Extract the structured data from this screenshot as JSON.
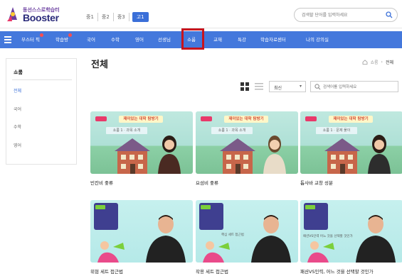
{
  "header": {
    "logo_sub": "동선스스로학습터",
    "logo_main": "Booster",
    "grade_tabs": [
      "중1",
      "중2",
      "중3",
      "고1"
    ],
    "active_grade": "고1",
    "search_placeholder": "검색할 단어를 입력하세요",
    "icons": {
      "logo": "booster-logo",
      "search": "search-icon"
    }
  },
  "nav": {
    "items": [
      "부스터 픽",
      "학습방",
      "국어",
      "수학",
      "영어",
      "선생님",
      "쇼룸",
      "교재",
      "특강",
      "학습자료센터",
      "나의 강의실"
    ],
    "badge_items": [
      "부스터 픽",
      "학습방"
    ],
    "highlighted": "쇼룸",
    "icon": "hamburger-icon",
    "colors": {
      "bar": "#4478dc",
      "highlight": "#c8141e",
      "badge": "#ff4d4d"
    }
  },
  "sidebar": {
    "title": "쇼룸",
    "items": [
      "전체",
      "국어",
      "수학",
      "영어"
    ],
    "active": "전체"
  },
  "main": {
    "title": "전체",
    "breadcrumb": [
      "쇼룸",
      "전체"
    ],
    "sort_label": "최신",
    "search_placeholder": "검색어를 입력하세요",
    "icons": {
      "home": "home-icon",
      "grid": "grid-view-icon",
      "list": "list-view-icon",
      "chevron": "chevron-down-icon",
      "search": "search-icon"
    }
  },
  "cards": [
    {
      "title": "빈칸비 좋류",
      "banner": "재미있는 대학 탐방기",
      "box": "쇼룸 1 · 과목 소개"
    },
    {
      "title": "요섬비 좋류",
      "banner": "재미있는 대학 탐방기",
      "box": "쇼룸 1 · 과목 소개"
    },
    {
      "title": "톱사바 교창 성분",
      "banner": "재미있는 대학 탐방기",
      "box": "쇼룸 1 · 문제 풀이"
    },
    {
      "title": "위협 세트 접근법",
      "caption": ""
    },
    {
      "title": "작용 세트 접근법",
      "caption": "핵심 세트 접근법"
    },
    {
      "title": "패션VS인력, 어느 것을 선택할 것인가",
      "caption": "패션VS인력 어느 것을 선택할 것인가"
    }
  ]
}
